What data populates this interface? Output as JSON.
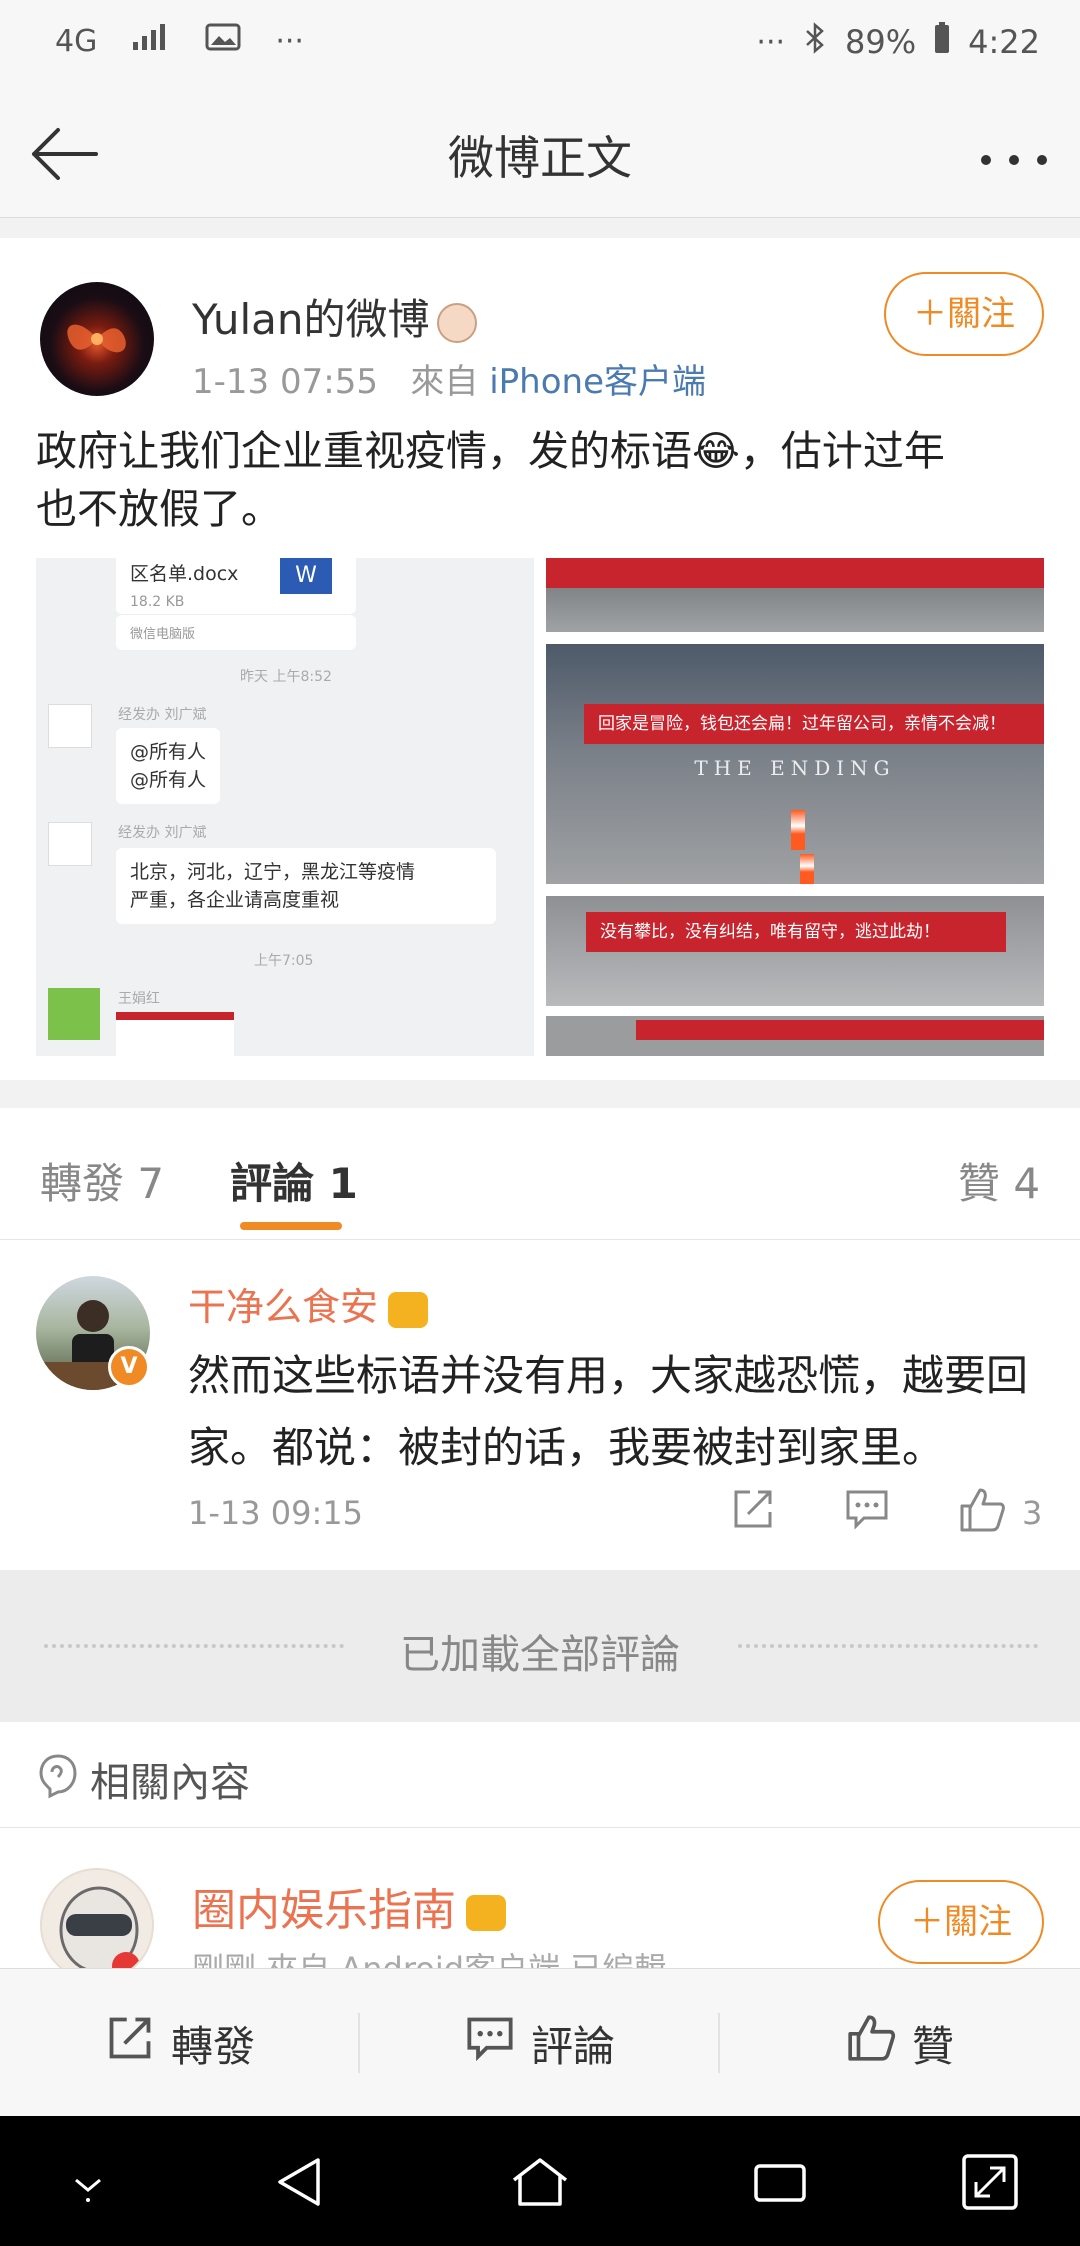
{
  "status_bar": {
    "network": "4G",
    "more_left": "···",
    "more_right": "···",
    "battery": "89%",
    "time": "4:22"
  },
  "nav": {
    "title": "微博正文"
  },
  "post": {
    "author": "Yulan的微博",
    "time": "1-13 07:55",
    "source_prefix": "來自",
    "source": "iPhone客户端",
    "follow_label": "＋關注",
    "text_line1": "政府让我们企业重视疫情，发的标语😂，估计过年",
    "text_line2": "也不放假了。",
    "image_left": {
      "file_name": "区名单.docx",
      "file_size": "18.2 KB",
      "file_source": "微信电脑版",
      "file_type_icon": "W",
      "time1": "昨天 上午8:52",
      "sender": "经发办 刘广斌",
      "mention1": "@所有人",
      "mention2": "@所有人",
      "sender2": "经发办 刘广斌",
      "notice_line1": "北京，河北，辽宁，黑龙江等疫情",
      "notice_line2": "严重，各企业请高度重视",
      "time2": "上午7:05",
      "sender3": "王娟红"
    },
    "image_right": {
      "banner1": "回家是冒险，钱包还会扁！过年留公司，亲情不会减！",
      "watermark": "THE ENDING",
      "banner2": "没有攀比，没有纠结，唯有留守，逃过此劫！"
    }
  },
  "tabs": {
    "repost": "轉發 7",
    "comments": "評論 1",
    "likes": "贊 4"
  },
  "comment": {
    "author": "干净么食安",
    "v_badge": "V",
    "text": "然而这些标语并没有用，大家越恐慌，越要回家。都说：被封的话，我要被封到家里。",
    "time": "1-13 09:15",
    "like_count": "3"
  },
  "loaded_text": "已加載全部評論",
  "related": {
    "title": "相關內容",
    "author": "圈内娱乐指南",
    "meta": "剛剛  來自 Android客户端  已編輯",
    "follow_label": "＋關注"
  },
  "toolbar": {
    "repost": "轉發",
    "comment": "評論",
    "like": "贊"
  },
  "colors": {
    "accent": "#f08a24",
    "name_orange": "#eb7350",
    "link_blue": "#4a7ab0",
    "banner_red": "#c8242e"
  }
}
